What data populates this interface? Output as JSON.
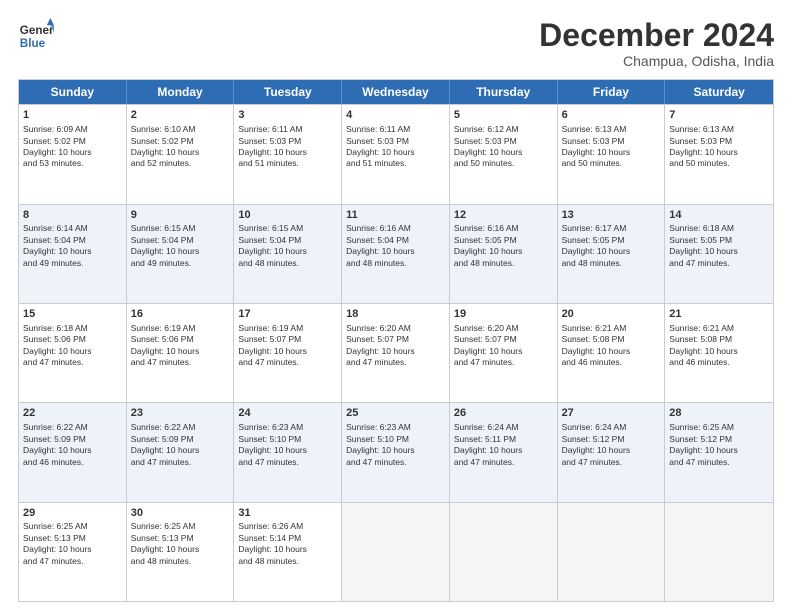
{
  "logo": {
    "line1": "General",
    "line2": "Blue"
  },
  "title": "December 2024",
  "location": "Champua, Odisha, India",
  "weekdays": [
    "Sunday",
    "Monday",
    "Tuesday",
    "Wednesday",
    "Thursday",
    "Friday",
    "Saturday"
  ],
  "rows": [
    {
      "alt": false,
      "cells": [
        {
          "day": "1",
          "info": "Sunrise: 6:09 AM\nSunset: 5:02 PM\nDaylight: 10 hours\nand 53 minutes."
        },
        {
          "day": "2",
          "info": "Sunrise: 6:10 AM\nSunset: 5:02 PM\nDaylight: 10 hours\nand 52 minutes."
        },
        {
          "day": "3",
          "info": "Sunrise: 6:11 AM\nSunset: 5:03 PM\nDaylight: 10 hours\nand 51 minutes."
        },
        {
          "day": "4",
          "info": "Sunrise: 6:11 AM\nSunset: 5:03 PM\nDaylight: 10 hours\nand 51 minutes."
        },
        {
          "day": "5",
          "info": "Sunrise: 6:12 AM\nSunset: 5:03 PM\nDaylight: 10 hours\nand 50 minutes."
        },
        {
          "day": "6",
          "info": "Sunrise: 6:13 AM\nSunset: 5:03 PM\nDaylight: 10 hours\nand 50 minutes."
        },
        {
          "day": "7",
          "info": "Sunrise: 6:13 AM\nSunset: 5:03 PM\nDaylight: 10 hours\nand 50 minutes."
        }
      ]
    },
    {
      "alt": true,
      "cells": [
        {
          "day": "8",
          "info": "Sunrise: 6:14 AM\nSunset: 5:04 PM\nDaylight: 10 hours\nand 49 minutes."
        },
        {
          "day": "9",
          "info": "Sunrise: 6:15 AM\nSunset: 5:04 PM\nDaylight: 10 hours\nand 49 minutes."
        },
        {
          "day": "10",
          "info": "Sunrise: 6:15 AM\nSunset: 5:04 PM\nDaylight: 10 hours\nand 48 minutes."
        },
        {
          "day": "11",
          "info": "Sunrise: 6:16 AM\nSunset: 5:04 PM\nDaylight: 10 hours\nand 48 minutes."
        },
        {
          "day": "12",
          "info": "Sunrise: 6:16 AM\nSunset: 5:05 PM\nDaylight: 10 hours\nand 48 minutes."
        },
        {
          "day": "13",
          "info": "Sunrise: 6:17 AM\nSunset: 5:05 PM\nDaylight: 10 hours\nand 48 minutes."
        },
        {
          "day": "14",
          "info": "Sunrise: 6:18 AM\nSunset: 5:05 PM\nDaylight: 10 hours\nand 47 minutes."
        }
      ]
    },
    {
      "alt": false,
      "cells": [
        {
          "day": "15",
          "info": "Sunrise: 6:18 AM\nSunset: 5:06 PM\nDaylight: 10 hours\nand 47 minutes."
        },
        {
          "day": "16",
          "info": "Sunrise: 6:19 AM\nSunset: 5:06 PM\nDaylight: 10 hours\nand 47 minutes."
        },
        {
          "day": "17",
          "info": "Sunrise: 6:19 AM\nSunset: 5:07 PM\nDaylight: 10 hours\nand 47 minutes."
        },
        {
          "day": "18",
          "info": "Sunrise: 6:20 AM\nSunset: 5:07 PM\nDaylight: 10 hours\nand 47 minutes."
        },
        {
          "day": "19",
          "info": "Sunrise: 6:20 AM\nSunset: 5:07 PM\nDaylight: 10 hours\nand 47 minutes."
        },
        {
          "day": "20",
          "info": "Sunrise: 6:21 AM\nSunset: 5:08 PM\nDaylight: 10 hours\nand 46 minutes."
        },
        {
          "day": "21",
          "info": "Sunrise: 6:21 AM\nSunset: 5:08 PM\nDaylight: 10 hours\nand 46 minutes."
        }
      ]
    },
    {
      "alt": true,
      "cells": [
        {
          "day": "22",
          "info": "Sunrise: 6:22 AM\nSunset: 5:09 PM\nDaylight: 10 hours\nand 46 minutes."
        },
        {
          "day": "23",
          "info": "Sunrise: 6:22 AM\nSunset: 5:09 PM\nDaylight: 10 hours\nand 47 minutes."
        },
        {
          "day": "24",
          "info": "Sunrise: 6:23 AM\nSunset: 5:10 PM\nDaylight: 10 hours\nand 47 minutes."
        },
        {
          "day": "25",
          "info": "Sunrise: 6:23 AM\nSunset: 5:10 PM\nDaylight: 10 hours\nand 47 minutes."
        },
        {
          "day": "26",
          "info": "Sunrise: 6:24 AM\nSunset: 5:11 PM\nDaylight: 10 hours\nand 47 minutes."
        },
        {
          "day": "27",
          "info": "Sunrise: 6:24 AM\nSunset: 5:12 PM\nDaylight: 10 hours\nand 47 minutes."
        },
        {
          "day": "28",
          "info": "Sunrise: 6:25 AM\nSunset: 5:12 PM\nDaylight: 10 hours\nand 47 minutes."
        }
      ]
    },
    {
      "alt": false,
      "cells": [
        {
          "day": "29",
          "info": "Sunrise: 6:25 AM\nSunset: 5:13 PM\nDaylight: 10 hours\nand 47 minutes."
        },
        {
          "day": "30",
          "info": "Sunrise: 6:25 AM\nSunset: 5:13 PM\nDaylight: 10 hours\nand 48 minutes."
        },
        {
          "day": "31",
          "info": "Sunrise: 6:26 AM\nSunset: 5:14 PM\nDaylight: 10 hours\nand 48 minutes."
        },
        {
          "day": "",
          "info": ""
        },
        {
          "day": "",
          "info": ""
        },
        {
          "day": "",
          "info": ""
        },
        {
          "day": "",
          "info": ""
        }
      ]
    }
  ]
}
